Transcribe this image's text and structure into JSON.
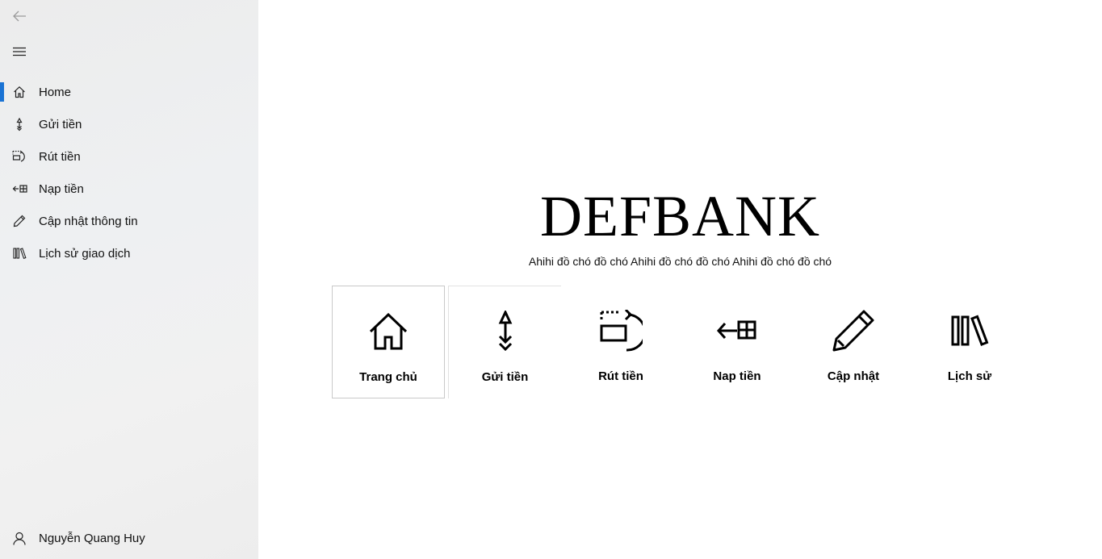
{
  "sidebar": {
    "items": [
      {
        "label": "Home",
        "icon": "home-icon"
      },
      {
        "label": "Gửi tiền",
        "icon": "send-arrow-icon"
      },
      {
        "label": "Rút tiền",
        "icon": "withdraw-icon"
      },
      {
        "label": "Nạp tiền",
        "icon": "deposit-icon"
      },
      {
        "label": "Cập nhật thông tin",
        "icon": "pencil-icon"
      },
      {
        "label": "Lịch sử giao dịch",
        "icon": "library-icon"
      }
    ],
    "active_index": 0,
    "user": {
      "name": "Nguyễn Quang Huy",
      "icon": "user-icon"
    }
  },
  "main": {
    "title": "DEFBANK",
    "subtitle": "Ahihi đồ chó đồ chó Ahihi đồ chó đồ chó Ahihi đồ chó đồ chó",
    "tiles": [
      {
        "label": "Trang chủ",
        "icon": "home-icon"
      },
      {
        "label": "Gửi tiền",
        "icon": "send-arrow-icon"
      },
      {
        "label": "Rút tiền",
        "icon": "withdraw-icon"
      },
      {
        "label": "Nap tiền",
        "icon": "deposit-icon"
      },
      {
        "label": "Cập nhật",
        "icon": "pencil-icon"
      },
      {
        "label": "Lịch sử",
        "icon": "library-icon"
      }
    ]
  },
  "colors": {
    "accent": "#1a73d4",
    "sidebar_bg": "#eeeeee"
  }
}
